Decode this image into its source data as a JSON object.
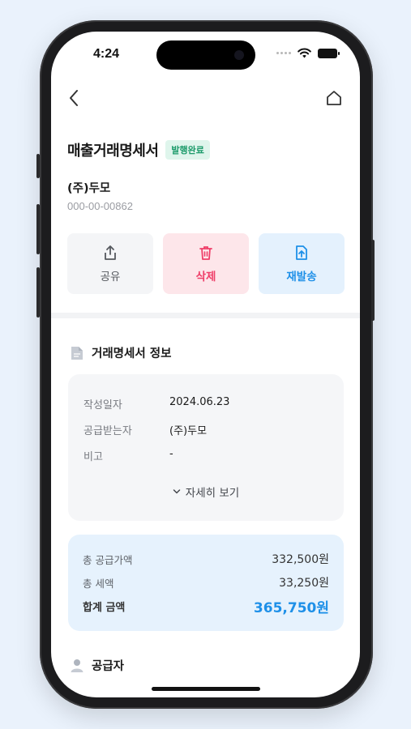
{
  "status": {
    "time": "4:24"
  },
  "header": {
    "title": "매출거래명세서",
    "badge": "발행완료"
  },
  "company": {
    "name": "(주)두모",
    "business_number": "000-00-00862"
  },
  "actions": {
    "share": "공유",
    "delete": "삭제",
    "resend": "재발송"
  },
  "info": {
    "title": "거래명세서 정보",
    "rows": [
      {
        "label": "작성일자",
        "value": "2024.06.23"
      },
      {
        "label": "공급받는자",
        "value": "(주)두모"
      },
      {
        "label": "비고",
        "value": "-"
      }
    ],
    "more": "자세히 보기"
  },
  "summary": {
    "supply_label": "총 공급가액",
    "supply_value": "332,500원",
    "tax_label": "총 세액",
    "tax_value": "33,250원",
    "total_label": "합계 금액",
    "total_value": "365,750원"
  },
  "supplier": {
    "title": "공급자"
  },
  "colors": {
    "accent": "#1e90e8",
    "danger": "#ef3f69",
    "success": "#1b9a6a"
  }
}
